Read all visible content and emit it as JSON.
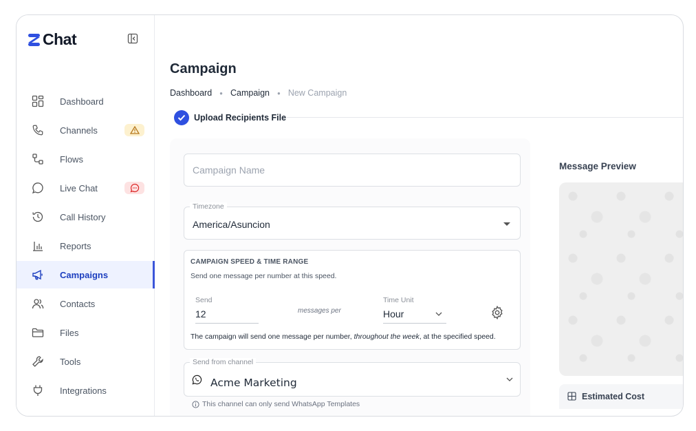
{
  "app": {
    "name": "Chat"
  },
  "sidebar": {
    "items": [
      {
        "label": "Dashboard",
        "icon": "grid-icon"
      },
      {
        "label": "Channels",
        "icon": "phone-icon",
        "badge": "warning-icon"
      },
      {
        "label": "Flows",
        "icon": "flow-icon"
      },
      {
        "label": "Live Chat",
        "icon": "chat-bubble-icon",
        "badge": "message-alert-icon"
      },
      {
        "label": "Call History",
        "icon": "history-icon"
      },
      {
        "label": "Reports",
        "icon": "bar-chart-icon"
      },
      {
        "label": "Campaigns",
        "icon": "megaphone-icon",
        "active": true
      },
      {
        "label": "Contacts",
        "icon": "users-icon"
      },
      {
        "label": "Files",
        "icon": "folder-icon"
      },
      {
        "label": "Tools",
        "icon": "wrench-icon"
      },
      {
        "label": "Integrations",
        "icon": "plug-icon"
      }
    ]
  },
  "page": {
    "title": "Campaign",
    "breadcrumb": [
      "Dashboard",
      "Campaign",
      "New Campaign"
    ],
    "step": "Upload Recipients File"
  },
  "form": {
    "campaign_name_placeholder": "Campaign Name",
    "timezone_label": "Timezone",
    "timezone_value": "America/Asuncion",
    "speed": {
      "title": "CAMPAIGN SPEED & TIME RANGE",
      "subtitle": "Send one message per number at this speed.",
      "send_label": "Send",
      "send_value": "12",
      "messages_per": "messages per",
      "unit_label": "Time Unit",
      "unit_value": "Hour",
      "note_prefix": "The campaign will send one message per number, ",
      "note_emphasis": "throughout the week",
      "note_suffix": ", at the specified speed."
    },
    "channel_label": "Send from channel",
    "channel_value": "Acme Marketing",
    "channel_note": "This channel can only send WhatsApp Templates"
  },
  "preview": {
    "title": "Message Preview",
    "estimated_cost_label": "Estimated Cost"
  },
  "colors": {
    "accent": "#2f50e0",
    "active_bg": "#eef2ff",
    "warning_bg": "#fdf1cf",
    "alert_bg": "#fde2e2"
  }
}
